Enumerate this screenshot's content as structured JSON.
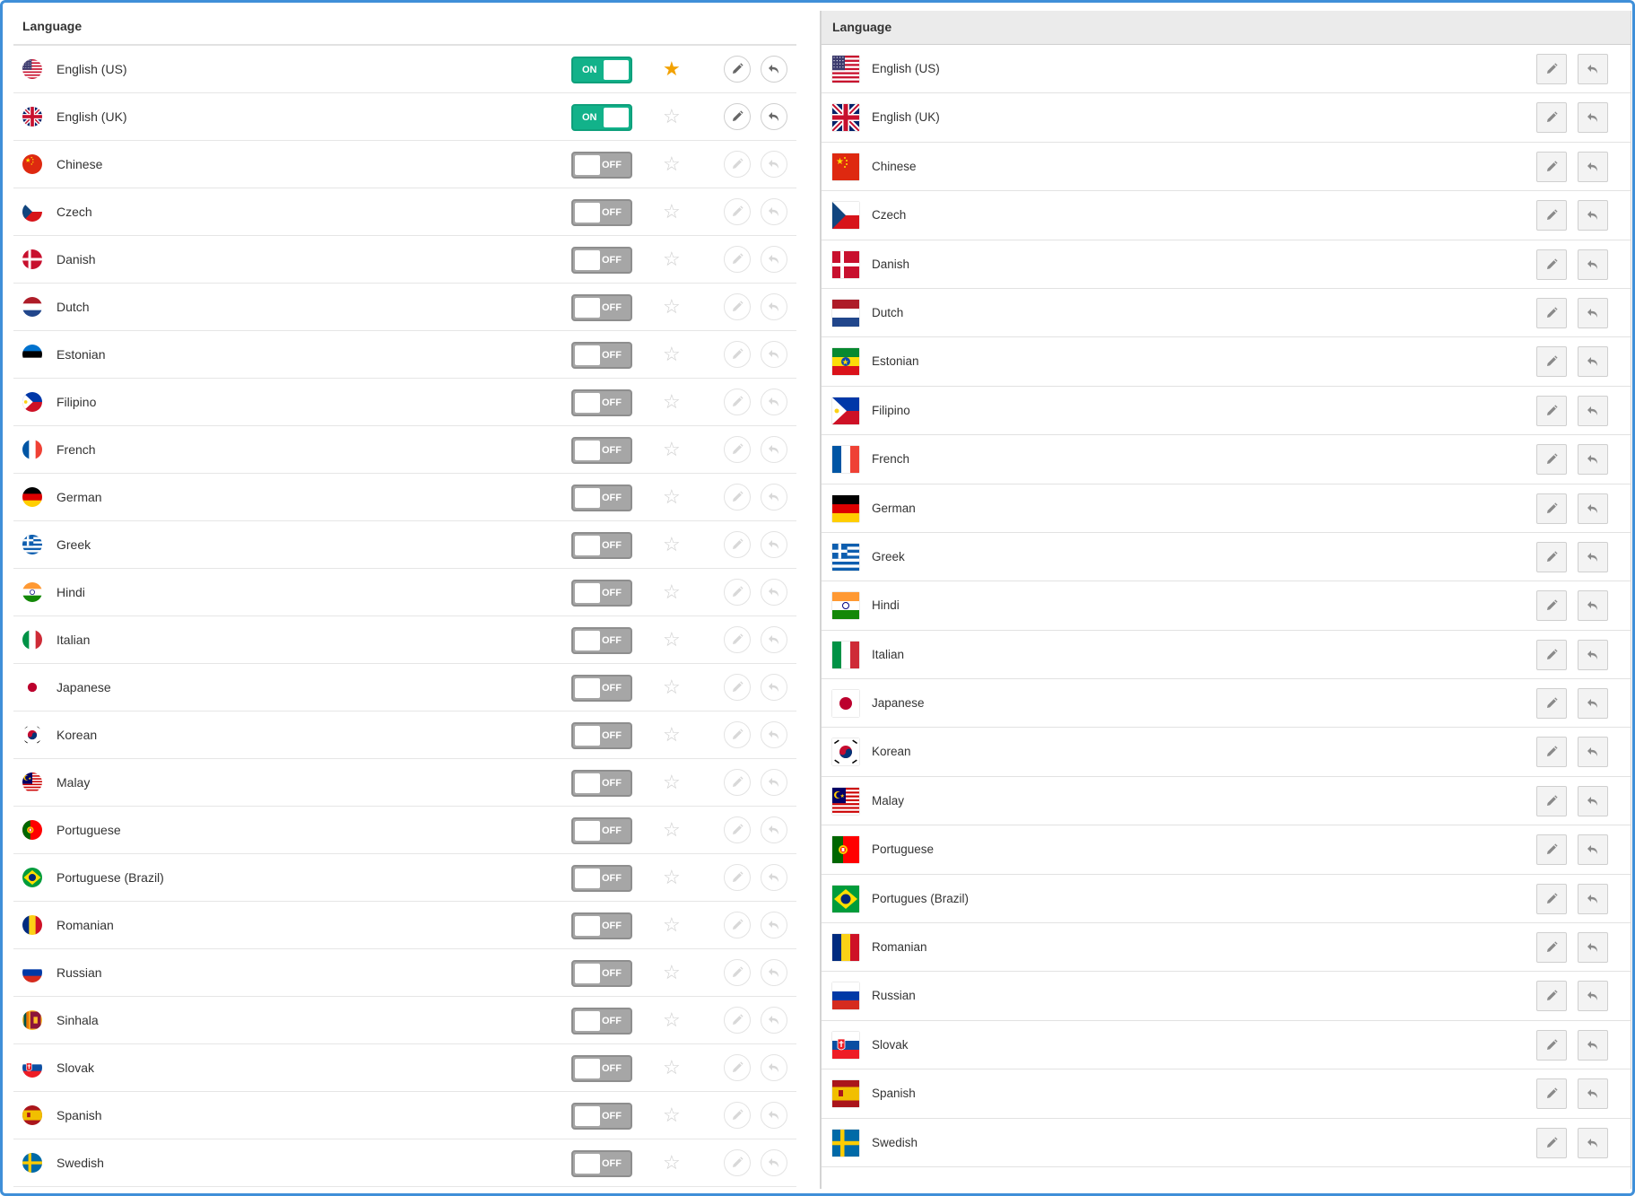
{
  "left_panel": {
    "header": "Language",
    "rows": [
      {
        "name": "English (US)",
        "toggle": "ON",
        "on": true,
        "starred": true,
        "flag": "us"
      },
      {
        "name": "English (UK)",
        "toggle": "ON",
        "on": true,
        "starred": false,
        "flag": "uk"
      },
      {
        "name": "Chinese",
        "toggle": "OFF",
        "on": false,
        "starred": false,
        "flag": "cn"
      },
      {
        "name": "Czech",
        "toggle": "OFF",
        "on": false,
        "starred": false,
        "flag": "cz"
      },
      {
        "name": "Danish",
        "toggle": "OFF",
        "on": false,
        "starred": false,
        "flag": "dk"
      },
      {
        "name": "Dutch",
        "toggle": "OFF",
        "on": false,
        "starred": false,
        "flag": "nl"
      },
      {
        "name": "Estonian",
        "toggle": "OFF",
        "on": false,
        "starred": false,
        "flag": "ee"
      },
      {
        "name": "Filipino",
        "toggle": "OFF",
        "on": false,
        "starred": false,
        "flag": "ph"
      },
      {
        "name": "French",
        "toggle": "OFF",
        "on": false,
        "starred": false,
        "flag": "fr"
      },
      {
        "name": "German",
        "toggle": "OFF",
        "on": false,
        "starred": false,
        "flag": "de"
      },
      {
        "name": "Greek",
        "toggle": "OFF",
        "on": false,
        "starred": false,
        "flag": "gr"
      },
      {
        "name": "Hindi",
        "toggle": "OFF",
        "on": false,
        "starred": false,
        "flag": "in"
      },
      {
        "name": "Italian",
        "toggle": "OFF",
        "on": false,
        "starred": false,
        "flag": "it"
      },
      {
        "name": "Japanese",
        "toggle": "OFF",
        "on": false,
        "starred": false,
        "flag": "jp"
      },
      {
        "name": "Korean",
        "toggle": "OFF",
        "on": false,
        "starred": false,
        "flag": "kr"
      },
      {
        "name": "Malay",
        "toggle": "OFF",
        "on": false,
        "starred": false,
        "flag": "my"
      },
      {
        "name": "Portuguese",
        "toggle": "OFF",
        "on": false,
        "starred": false,
        "flag": "pt"
      },
      {
        "name": "Portuguese (Brazil)",
        "toggle": "OFF",
        "on": false,
        "starred": false,
        "flag": "br"
      },
      {
        "name": "Romanian",
        "toggle": "OFF",
        "on": false,
        "starred": false,
        "flag": "ro"
      },
      {
        "name": "Russian",
        "toggle": "OFF",
        "on": false,
        "starred": false,
        "flag": "ru"
      },
      {
        "name": "Sinhala",
        "toggle": "OFF",
        "on": false,
        "starred": false,
        "flag": "lk"
      },
      {
        "name": "Slovak",
        "toggle": "OFF",
        "on": false,
        "starred": false,
        "flag": "sk"
      },
      {
        "name": "Spanish",
        "toggle": "OFF",
        "on": false,
        "starred": false,
        "flag": "es"
      },
      {
        "name": "Swedish",
        "toggle": "OFF",
        "on": false,
        "starred": false,
        "flag": "se"
      }
    ]
  },
  "right_panel": {
    "header": "Language",
    "rows": [
      {
        "name": "English (US)",
        "flag": "us"
      },
      {
        "name": "English (UK)",
        "flag": "uk"
      },
      {
        "name": "Chinese",
        "flag": "cn"
      },
      {
        "name": "Czech",
        "flag": "cz"
      },
      {
        "name": "Danish",
        "flag": "dk"
      },
      {
        "name": "Dutch",
        "flag": "nl"
      },
      {
        "name": "Estonian",
        "flag": "et"
      },
      {
        "name": "Filipino",
        "flag": "ph"
      },
      {
        "name": "French",
        "flag": "fr"
      },
      {
        "name": "German",
        "flag": "de"
      },
      {
        "name": "Greek",
        "flag": "gr"
      },
      {
        "name": "Hindi",
        "flag": "in"
      },
      {
        "name": "Italian",
        "flag": "it"
      },
      {
        "name": "Japanese",
        "flag": "jp"
      },
      {
        "name": "Korean",
        "flag": "kr"
      },
      {
        "name": "Malay",
        "flag": "my"
      },
      {
        "name": "Portuguese",
        "flag": "pt"
      },
      {
        "name": "Portugues (Brazil)",
        "flag": "br"
      },
      {
        "name": "Romanian",
        "flag": "ro"
      },
      {
        "name": "Russian",
        "flag": "ru"
      },
      {
        "name": "Slovak",
        "flag": "sk"
      },
      {
        "name": "Spanish",
        "flag": "es"
      },
      {
        "name": "Swedish",
        "flag": "se"
      }
    ]
  },
  "colors": {
    "toggle_on": "#12b28a",
    "toggle_off": "#a6a6a6",
    "star": "#f2a100",
    "frame": "#3f8fd8"
  },
  "icons": {
    "edit": "pencil-icon",
    "revert": "undo-icon",
    "favorite": "star-icon"
  }
}
